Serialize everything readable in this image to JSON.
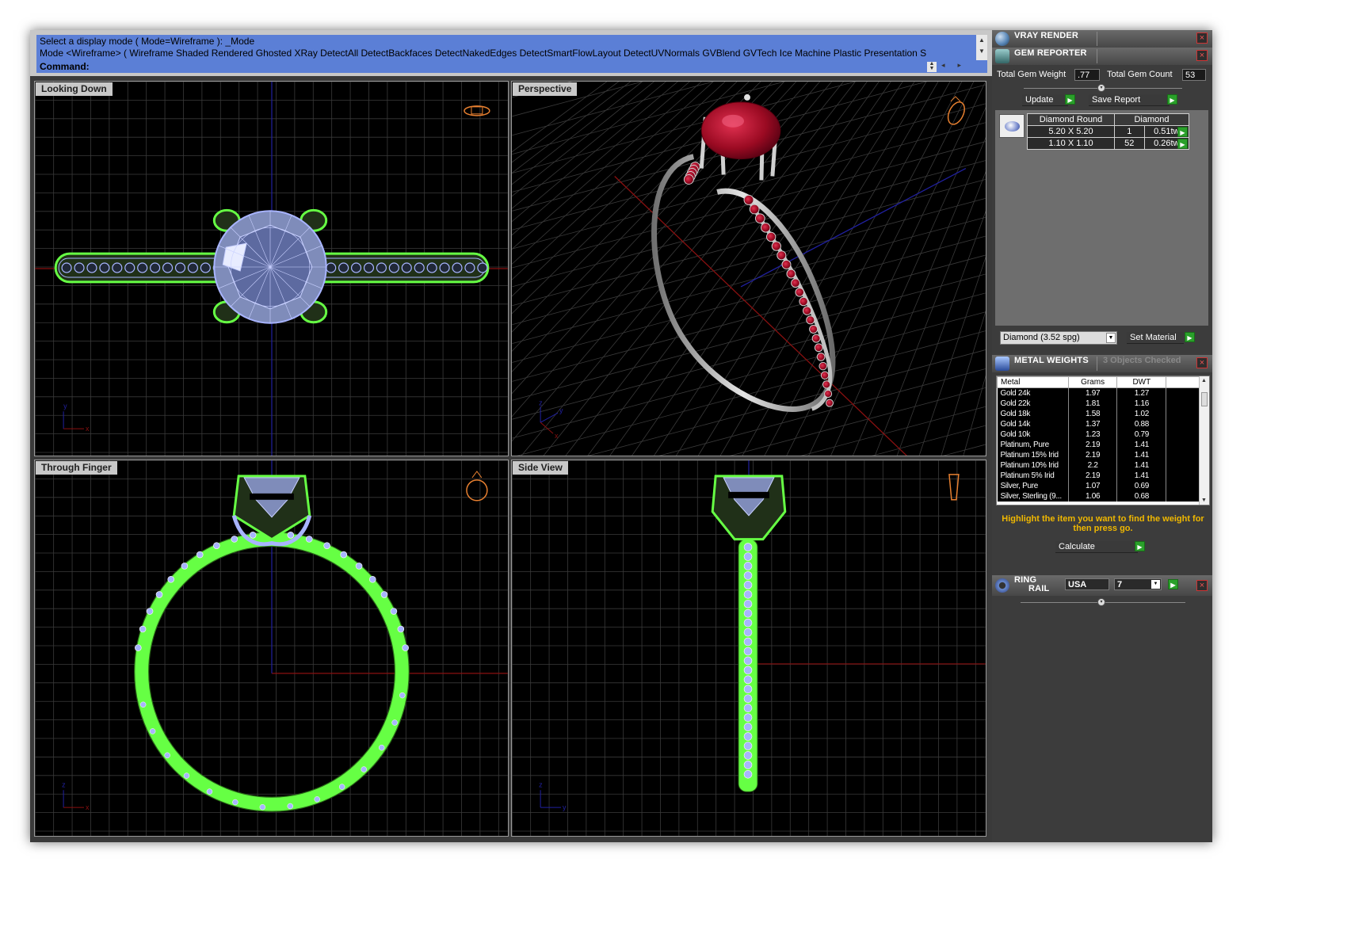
{
  "command_area": {
    "history_lines": [
      "Select a display mode ( Mode=Wireframe ): _Mode",
      "Mode <Wireframe> ( Wireframe  Shaded  Rendered  Ghosted  XRay  DetectAll  DetectBackfaces  DetectNakedEdges  DetectSmartFlowLayout  DetectUVNormals  GVBlend  GVTech  Ice  Machine  Plastic  Presentation  S"
    ],
    "command_label": "Command:"
  },
  "viewports": [
    {
      "title": "Looking Down",
      "axes": [
        "y",
        "x"
      ]
    },
    {
      "title": "Perspective",
      "axes": [
        "z",
        "y",
        "x"
      ]
    },
    {
      "title": "Through Finger",
      "axes": [
        "z",
        "x"
      ]
    },
    {
      "title": "Side View",
      "axes": [
        "z",
        "y"
      ]
    }
  ],
  "colors": {
    "wire_green": "#66ff44",
    "wire_blue": "#a8b4ff",
    "grid": "#3a3a3a",
    "axis_red": "#8a1010",
    "axis_blue": "#2020a0",
    "ruby": "#9a0a22",
    "metal": "#b8b8b8",
    "command_bg": "#5b7fd6",
    "hint_text": "#f0b800"
  },
  "panels": {
    "vray": {
      "title": "VRAY RENDER"
    },
    "gem_reporter": {
      "title": "GEM REPORTER",
      "total_gem_weight_label": "Total Gem Weight",
      "total_gem_weight": ".77",
      "total_gem_count_label": "Total Gem Count",
      "total_gem_count": "53",
      "update_label": "Update",
      "save_report_label": "Save Report",
      "table": {
        "headers": [
          "Diamond Round",
          "Diamond"
        ],
        "rows": [
          {
            "size": "5.20 X 5.20",
            "count": "1",
            "weight": "0.51tw"
          },
          {
            "size": "1.10 X 1.10",
            "count": "52",
            "weight": "0.26tw"
          }
        ]
      },
      "material_select": "Diamond     (3.52 spg)",
      "set_material_label": "Set Material"
    },
    "metal_weights": {
      "title": "METAL WEIGHTS",
      "status": "3 Objects Checked",
      "headers": [
        "Metal",
        "Grams",
        "DWT"
      ],
      "rows": [
        {
          "metal": "Gold 24k",
          "grams": "1.97",
          "dwt": "1.27"
        },
        {
          "metal": "Gold 22k",
          "grams": "1.81",
          "dwt": "1.16"
        },
        {
          "metal": "Gold 18k",
          "grams": "1.58",
          "dwt": "1.02"
        },
        {
          "metal": "Gold 14k",
          "grams": "1.37",
          "dwt": "0.88"
        },
        {
          "metal": "Gold 10k",
          "grams": "1.23",
          "dwt": "0.79"
        },
        {
          "metal": "Platinum, Pure",
          "grams": "2.19",
          "dwt": "1.41"
        },
        {
          "metal": "Platinum 15% Irid",
          "grams": "2.19",
          "dwt": "1.41"
        },
        {
          "metal": "Platinum 10% Irid",
          "grams": "2.2",
          "dwt": "1.41"
        },
        {
          "metal": "Platinum 5% Irid",
          "grams": "2.19",
          "dwt": "1.41"
        },
        {
          "metal": "Silver, Pure",
          "grams": "1.07",
          "dwt": "0.69"
        },
        {
          "metal": "Silver, Sterling (9...",
          "grams": "1.06",
          "dwt": "0.68"
        }
      ],
      "hint": "Highlight the item you want to find the weight for then press go.",
      "calculate_label": "Calculate"
    },
    "ring_rail": {
      "title_line1": "RING",
      "title_line2": "RAIL",
      "standard": "USA",
      "size": "7"
    }
  }
}
